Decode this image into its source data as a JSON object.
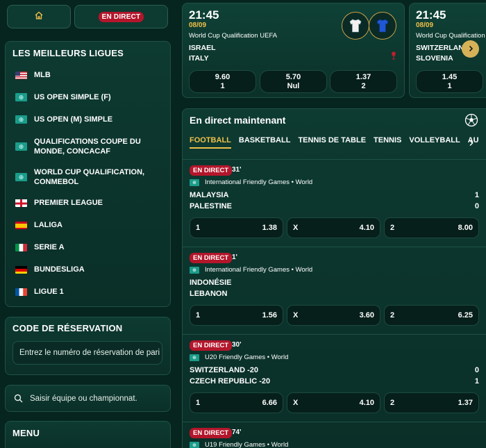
{
  "nav": {
    "live_label": "EN DIRECT"
  },
  "leagues": {
    "title": "LES MEILLEURS LIGUES",
    "items": [
      {
        "label": "MLB",
        "flag": "us"
      },
      {
        "label": "US OPEN SIMPLE (F)",
        "flag": "world"
      },
      {
        "label": "US OPEN (M) SIMPLE",
        "flag": "world"
      },
      {
        "label": "QUALIFICATIONS COUPE DU MONDE, CONCACAF",
        "flag": "world"
      },
      {
        "label": "WORLD CUP QUALIFICATION, CONMEBOL",
        "flag": "world"
      },
      {
        "label": "PREMIER LEAGUE",
        "flag": "england"
      },
      {
        "label": "LALIGA",
        "flag": "spain"
      },
      {
        "label": "SERIE A",
        "flag": "italy"
      },
      {
        "label": "BUNDESLIGA",
        "flag": "germany"
      },
      {
        "label": "LIGUE 1",
        "flag": "france"
      }
    ]
  },
  "reservation": {
    "title": "CODE DE RÉSERVATION",
    "placeholder": "Entrez le numéro de réservation de pari"
  },
  "search": {
    "placeholder": "Saisir équipe ou championnat."
  },
  "menu": {
    "title": "MENU"
  },
  "featured": [
    {
      "time": "21:45",
      "date": "08/09",
      "competition": "World Cup Qualification UEFA",
      "home": "ISRAEL",
      "away": "ITALY",
      "odds": [
        {
          "value": "9.60",
          "label": "1"
        },
        {
          "value": "5.70",
          "label": "Nul"
        },
        {
          "value": "1.37",
          "label": "2"
        }
      ]
    },
    {
      "time": "21:45",
      "date": "08/09",
      "competition": "World Cup Qualification",
      "home": "SWITZERLAND",
      "away": "SLOVENIA",
      "odds": [
        {
          "value": "1.45",
          "label": "1"
        }
      ]
    }
  ],
  "live": {
    "title": "En direct maintenant",
    "tabs": [
      "FOOTBALL",
      "BASKETBALL",
      "TENNIS DE TABLE",
      "TENNIS",
      "VOLLEYBALL",
      "AU"
    ],
    "matches": [
      {
        "badge": "EN DIRECT",
        "minute": "31'",
        "competition": "International Friendly Games • World",
        "home": "MALAYSIA",
        "away": "PALESTINE",
        "home_score": "1",
        "away_score": "0",
        "odds": [
          {
            "label": "1",
            "value": "1.38"
          },
          {
            "label": "X",
            "value": "4.10"
          },
          {
            "label": "2",
            "value": "8.00"
          }
        ]
      },
      {
        "badge": "EN DIRECT",
        "minute": "1'",
        "competition": "International Friendly Games • World",
        "home": "INDONÉSIE",
        "away": "LEBANON",
        "home_score": "",
        "away_score": "",
        "odds": [
          {
            "label": "1",
            "value": "1.56"
          },
          {
            "label": "X",
            "value": "3.60"
          },
          {
            "label": "2",
            "value": "6.25"
          }
        ]
      },
      {
        "badge": "EN DIRECT",
        "minute": "30'",
        "competition": "U20 Friendly Games • World",
        "home": "SWITZERLAND -20",
        "away": "CZECH REPUBLIC -20",
        "home_score": "0",
        "away_score": "1",
        "odds": [
          {
            "label": "1",
            "value": "6.66"
          },
          {
            "label": "X",
            "value": "4.10"
          },
          {
            "label": "2",
            "value": "1.37"
          }
        ]
      },
      {
        "badge": "EN DIRECT",
        "minute": "74'",
        "competition": "U19 Friendly Games • World"
      }
    ]
  },
  "colors": {
    "accent": "#f0c04a",
    "live_badge": "#b3162b",
    "background": "#06251f",
    "panel": "#0d3a31"
  }
}
